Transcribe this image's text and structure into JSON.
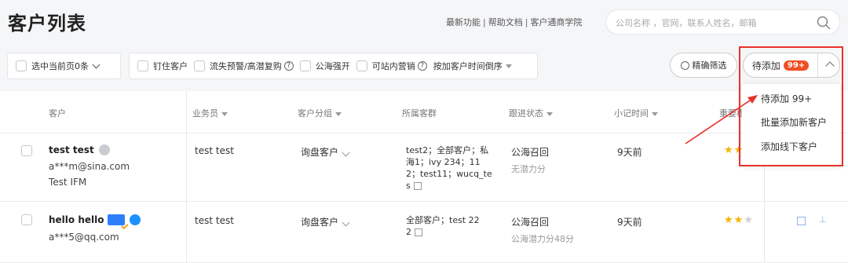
{
  "header": {
    "title": "客户列表",
    "links": [
      "最新功能",
      "帮助文档",
      "客户通商学院"
    ],
    "search_placeholder": "公司名称 ，官网，联系人姓名，邮箱"
  },
  "filters": {
    "select_page": "选中当前页0条",
    "items": [
      "钉住客户",
      "流失预警/高潜复购",
      "公海强开",
      "可站内营销"
    ],
    "sort_label": "按加客户时间倒序"
  },
  "actions": {
    "precise_filter": "精确筛选",
    "pending_add": "待添加",
    "pending_badge": "99+"
  },
  "dropdown": {
    "items": [
      "待添加 99+",
      "批量添加新客户",
      "添加线下客户"
    ]
  },
  "table": {
    "headers": [
      "客户",
      "业务员",
      "客户分组",
      "所属客群",
      "跟进状态",
      "小记时间",
      "重要程"
    ],
    "rows": [
      {
        "name": "test test",
        "email": "a***m@sina.com",
        "company": "Test IFM",
        "salesperson": "test test",
        "group": "询盘客户",
        "segment": "test2；全部客户；私海1；ivy 234；112；test11；wucq_tes",
        "status": "公海召回",
        "status_sub": "无潜力分",
        "note_time": "9天前",
        "stars": 2
      },
      {
        "name": "hello hello",
        "email": "a***5@qq.com",
        "company": "",
        "salesperson": "test test",
        "group": "询盘客户",
        "segment": "全部客户；test 222",
        "status": "公海召回",
        "status_sub": "公海潜力分48分",
        "note_time": "9天前",
        "stars": 2
      }
    ]
  },
  "colors": {
    "accent_red": "#e8322b",
    "badge": "#f04e23",
    "star": "#f5b400",
    "link_blue": "#2d7ff9"
  }
}
